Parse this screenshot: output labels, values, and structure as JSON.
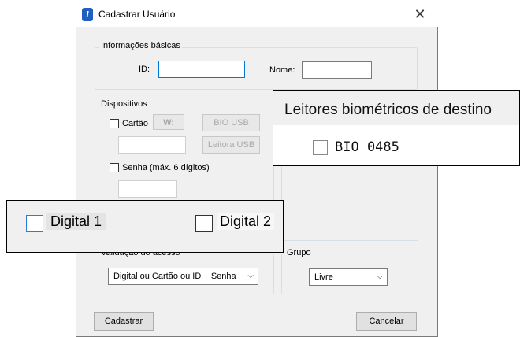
{
  "window": {
    "title": "Cadastrar Usuário",
    "close_symbol": "✕"
  },
  "basic_info": {
    "legend": "Informações básicas",
    "id_label": "ID:",
    "id_value": "",
    "name_label": "Nome:",
    "name_value": ""
  },
  "devices": {
    "legend": "Dispositivos",
    "card_label": "Cartão",
    "w_button": "W:",
    "bio_usb_button": "BIO USB",
    "usb_reader_button": "Leitora USB",
    "password_label": "Senha (máx. 6 dígitos)"
  },
  "validation": {
    "legend": "Validação do acesso",
    "selected": "Digital ou Cartão ou ID + Senha"
  },
  "group": {
    "legend": "Grupo",
    "selected": "Livre"
  },
  "buttons": {
    "register": "Cadastrar",
    "cancel": "Cancelar"
  },
  "callout_readers": {
    "title": "Leitores biométricos de destino",
    "item": "BIO 0485"
  },
  "callout_fingers": {
    "digital1": "Digital 1",
    "digital2": "Digital 2"
  },
  "colors": {
    "accent_blue": "#1f5fbf",
    "checkbox_focus": "#2b7cd3"
  }
}
